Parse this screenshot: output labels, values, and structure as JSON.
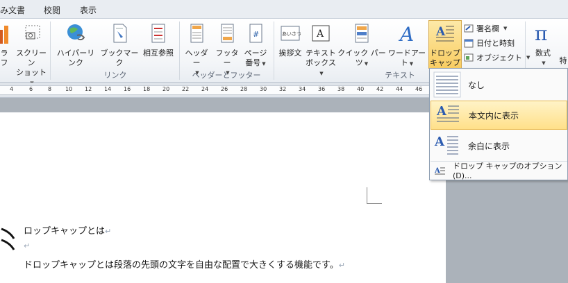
{
  "tabs": [
    "み文書",
    "校閲",
    "表示"
  ],
  "ribbon": {
    "cut_left": {
      "line1": "ラフ"
    },
    "screenshot": {
      "line1": "スクリーン",
      "line2": "ショット"
    },
    "hyperlink": "ハイパーリンク",
    "bookmark": "ブックマーク",
    "crossref": "相互参照",
    "group_link": "リンク",
    "header": "ヘッダー",
    "footer": "フッター",
    "page_number": {
      "line1": "ページ",
      "line2": "番号"
    },
    "group_header_footer": "ヘッダーとフッター",
    "greeting": "挨拶文",
    "textbox": {
      "line1": "テキスト",
      "line2": "ボックス"
    },
    "quickparts": "クイック パーツ",
    "wordart": "ワードアート",
    "dropcap": {
      "line1": "ドロップ",
      "line2": "キャップ"
    },
    "signature": "署名欄",
    "datetime": "日付と時刻",
    "object": "オブジェクト",
    "group_text": "テキスト",
    "equation": "数式",
    "special": "特",
    "greeting_icon_text": "あいさつ"
  },
  "ruler": {
    "ticks": [
      "4",
      "6",
      "8",
      "10",
      "12",
      "14",
      "16",
      "18",
      "20",
      "22",
      "24",
      "26",
      "28",
      "30",
      "32",
      "34",
      "36",
      "38",
      "40",
      "42",
      "44",
      "46"
    ]
  },
  "document": {
    "line1": "ロップキャップとは",
    "line3": "ドロップキャップとは段落の先頭の文字を自由な配置で大きくする機能です。",
    "para_mark": "↵"
  },
  "dropdown": {
    "items": [
      {
        "label": "なし"
      },
      {
        "label": "本文内に表示"
      },
      {
        "label": "余白に表示"
      }
    ],
    "options": "ドロップ キャップのオプション(D)..."
  }
}
